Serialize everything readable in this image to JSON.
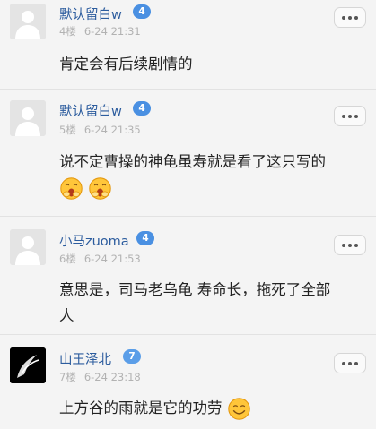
{
  "comments": [
    {
      "username": "默认留白w",
      "level": "4",
      "floor": "4楼",
      "time": "6-24 21:31",
      "text": "肯定会有后续剧情的",
      "avatar": "default-avatar",
      "emojis": []
    },
    {
      "username": "默认留白w",
      "level": "4",
      "floor": "5楼",
      "time": "6-24 21:35",
      "text": "说不定曹操的神龟虽寿就是看了这只写的",
      "avatar": "default-avatar",
      "emojis": [
        "yawn-emoji",
        "yawn-emoji"
      ]
    },
    {
      "username": "小马zuoma",
      "level": "4",
      "floor": "6楼",
      "time": "6-24 21:53",
      "text_line1": "意思是，司马老乌龟 寿命长，拖死了全部",
      "text_line2": "人",
      "avatar": "default-avatar",
      "emojis": []
    },
    {
      "username": "山王泽北",
      "level": "7",
      "floor": "7楼",
      "time": "6-24 23:18",
      "text": "上方谷的雨就是它的功劳",
      "avatar": "black-photo-avatar",
      "emojis": [
        "smile-emoji"
      ]
    }
  ],
  "colors": {
    "username": "#2c5c9e",
    "level_badge": "#4a90e2",
    "meta": "#b2b2b2",
    "background": "#f4f4f4"
  }
}
